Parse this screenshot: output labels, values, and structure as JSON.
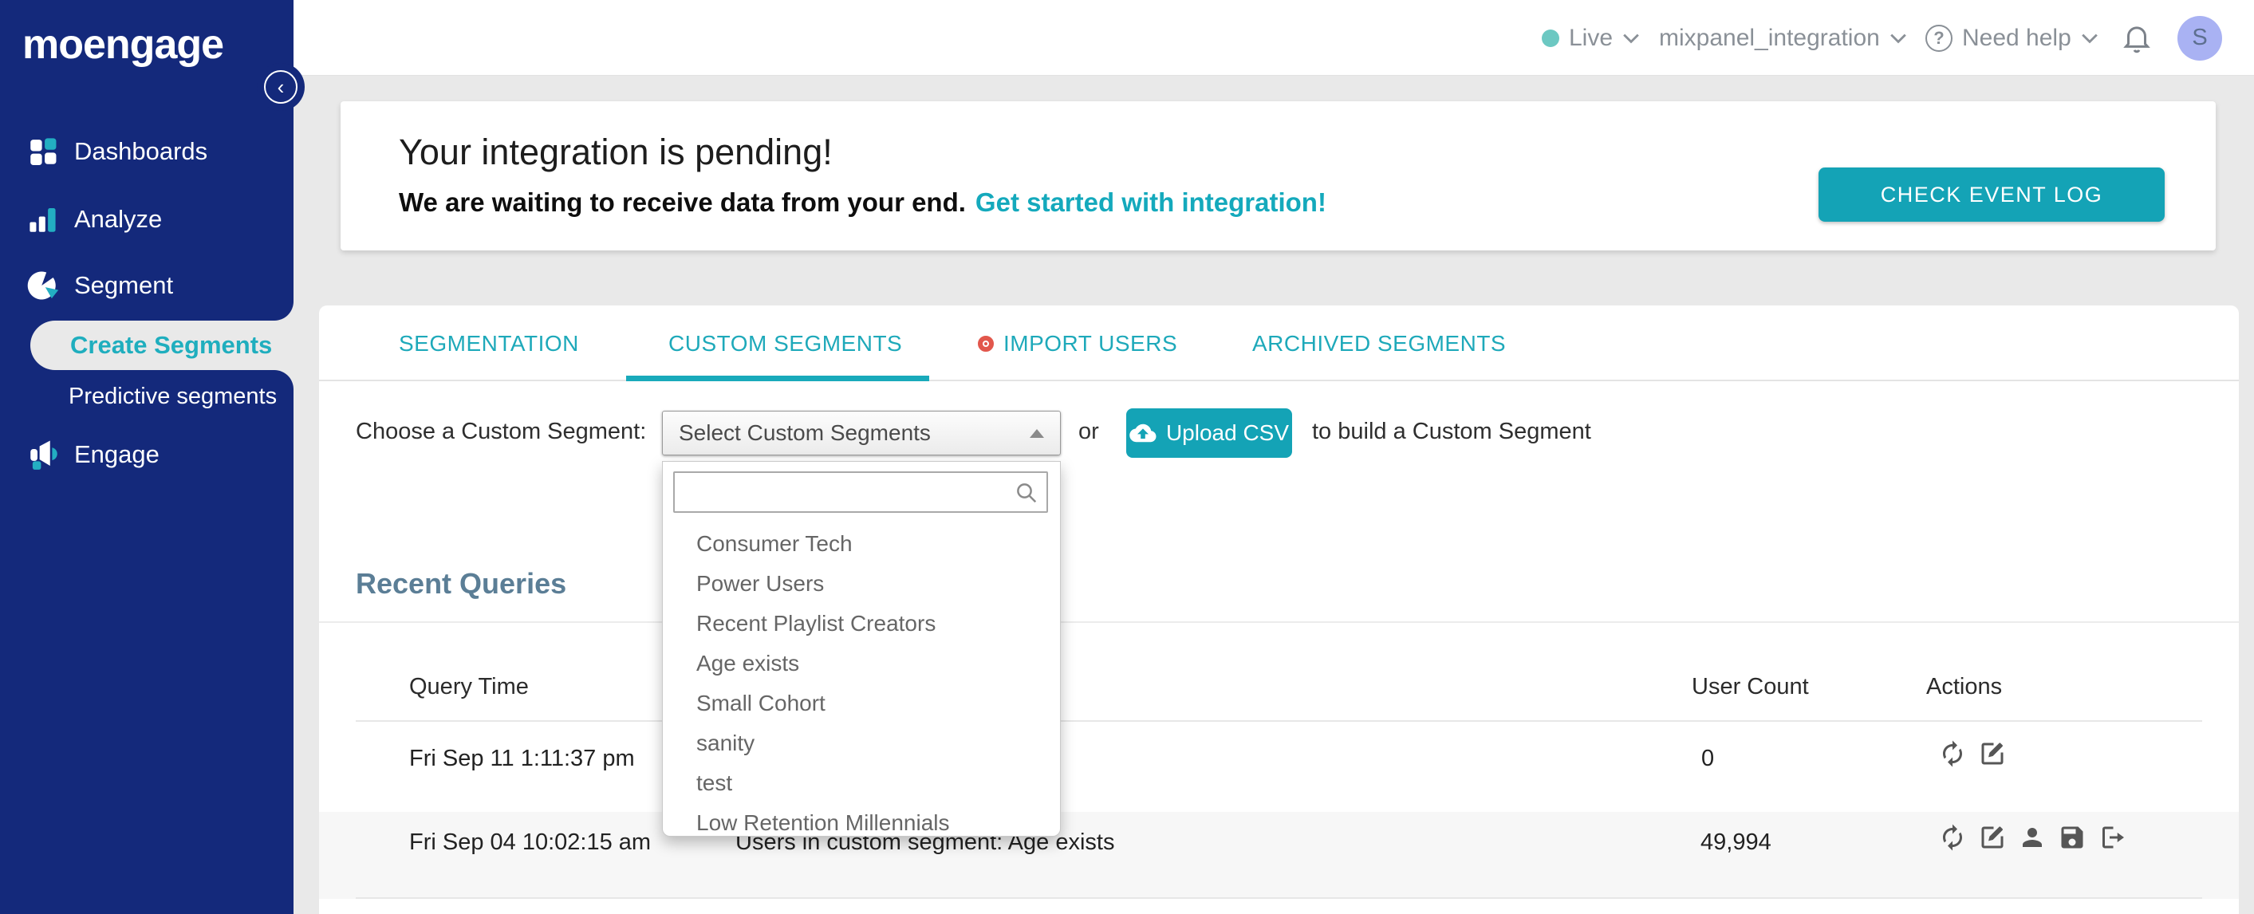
{
  "brand": {
    "logo_text": "moengage",
    "navy": "#14297b",
    "teal": "#14a3b6",
    "red": "#e2574c",
    "live_dot": "#6cc8c2",
    "avatar_bg": "#a9b2f3"
  },
  "topbar": {
    "env_label": "Live",
    "workspace": "mixpanel_integration",
    "help_label": "Need help",
    "avatar_initial": "S"
  },
  "sidebar": {
    "items": [
      {
        "label": "Dashboards"
      },
      {
        "label": "Analyze"
      },
      {
        "label": "Segment"
      },
      {
        "label": "Create Segments",
        "active": true
      },
      {
        "label": "Predictive segments"
      },
      {
        "label": "Engage"
      }
    ],
    "collapse_glyph": "‹"
  },
  "banner": {
    "title": "Your integration is pending!",
    "subtitle": "We are waiting to receive data from your end.",
    "link_label": "Get started with integration!",
    "button_label": "CHECK EVENT LOG"
  },
  "tabs": [
    {
      "label": "SEGMENTATION"
    },
    {
      "label": "CUSTOM SEGMENTS",
      "active": true
    },
    {
      "label": "IMPORT USERS",
      "badge": true
    },
    {
      "label": "ARCHIVED SEGMENTS"
    }
  ],
  "segment_picker": {
    "label": "Choose a Custom Segment:",
    "select_value": "Select Custom Segments",
    "or_text": "or",
    "upload_button": "Upload CSV",
    "suffix_text": "to build a Custom Segment",
    "search_value": "",
    "options": [
      "Consumer Tech",
      "Power Users",
      "Recent Playlist Creators",
      "Age exists",
      "Small Cohort",
      "sanity",
      "test",
      "Low Retention Millennials"
    ]
  },
  "recent_queries": {
    "title": "Recent Queries",
    "columns": [
      "Query Time",
      "User Count",
      "Actions"
    ],
    "rows": [
      {
        "time": "Fri Sep 11 1:11:37 pm",
        "info": "",
        "count": "0"
      },
      {
        "time": "Fri Sep 04 10:02:15 am",
        "info": "Users in custom segment: Age exists",
        "count": "49,994"
      }
    ]
  }
}
